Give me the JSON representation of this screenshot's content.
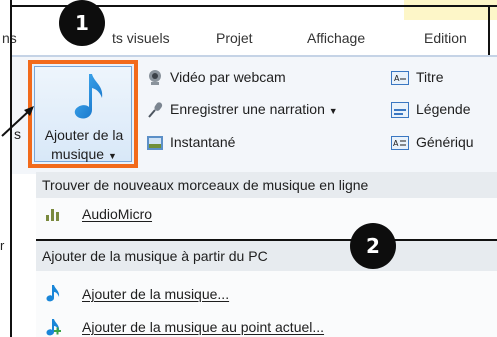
{
  "tabs": {
    "partial_left": "ns",
    "effets_visuels": "ts visuels",
    "projet": "Projet",
    "affichage": "Affichage",
    "edition": "Edition"
  },
  "ribbon": {
    "add_music_line1": "Ajouter de la",
    "add_music_line2": "musique",
    "webcam_video": "Vidéo par webcam",
    "record_narration": "Enregistrer une narration",
    "snapshot": "Instantané",
    "title": "Titre",
    "caption": "Légende",
    "credits": "Génériqu",
    "left_partial": "s"
  },
  "menu": {
    "find_online_header": "Trouver de nouveaux morceaux de musique en ligne",
    "audiomicro": "AudioMicro",
    "from_pc_header": "Ajouter de la musique à partir du PC",
    "add_music": "Ajouter de la musique...",
    "add_music_at_point": "Ajouter de la musique au point actuel..."
  },
  "callouts": {
    "one": "1",
    "two": "2",
    "left_partial_r": "r"
  },
  "colors": {
    "highlight_orange": "#f26a1b",
    "note_blue": "#1a86d8",
    "badge_black": "#0d0d0d"
  }
}
